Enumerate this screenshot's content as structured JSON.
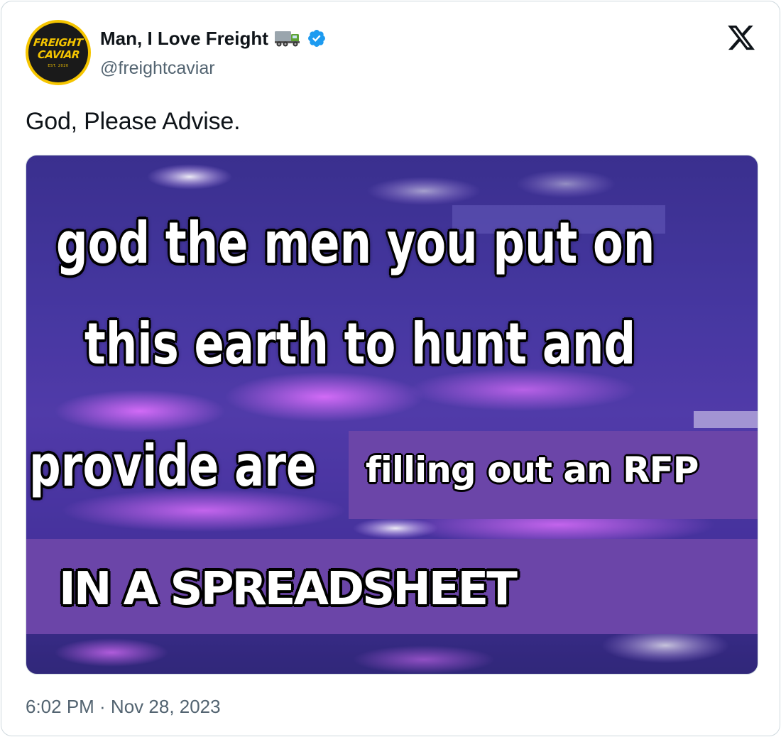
{
  "author": {
    "avatar": {
      "line1": "FREIGHT",
      "line2": "CAVIAR",
      "line3": "EST. 2020"
    },
    "display_name": "Man, I Love Freight",
    "name_emoji": "truck-icon",
    "verified": true,
    "handle": "@freightcaviar"
  },
  "platform_logo": "x-logo-icon",
  "tweet": {
    "text": "God, Please Advise."
  },
  "media": {
    "caption_lines": [
      "god the men you put on",
      "this earth to hunt and",
      "provide are"
    ],
    "overlay_1": "filling out an RFP",
    "overlay_2": "IN A SPREADSHEET",
    "overlay_color": "#6b45a8"
  },
  "timestamp": "6:02 PM · Nov 28, 2023",
  "colors": {
    "text_primary": "#0f1419",
    "text_secondary": "#536471",
    "verified_blue": "#1d9bf0",
    "border": "#cfd9de",
    "avatar_yellow": "#f5c500"
  }
}
